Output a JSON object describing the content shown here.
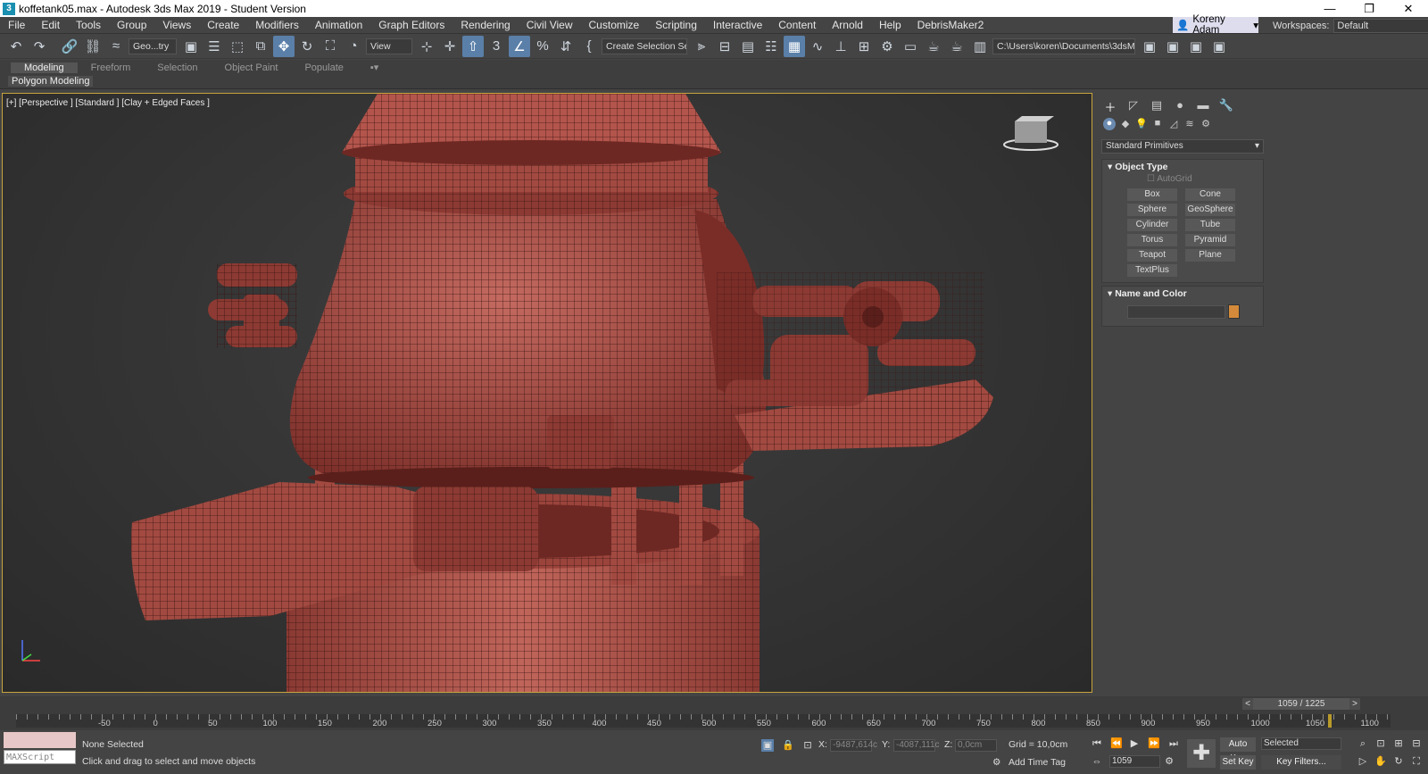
{
  "window": {
    "title": "koffetank05.max - Autodesk 3ds Max 2019 - Student Version",
    "app_icon": "3",
    "min": "—",
    "max": "❐",
    "close": "✕"
  },
  "menu": [
    "File",
    "Edit",
    "Tools",
    "Group",
    "Views",
    "Create",
    "Modifiers",
    "Animation",
    "Graph Editors",
    "Rendering",
    "Civil View",
    "Customize",
    "Scripting",
    "Interactive",
    "Content",
    "Arnold",
    "Help",
    "DebrisMaker2"
  ],
  "user": {
    "name": "Koreny Adam"
  },
  "workspace": {
    "label": "Workspaces:",
    "value": "Default"
  },
  "toolbar": {
    "selection_filter": "Geo...try",
    "ref_coord": "View",
    "named_selection": "Create Selection Se",
    "project_path": "C:\\Users\\koren\\Documents\\3dsMax"
  },
  "ribbon": {
    "tabs": [
      "Modeling",
      "Freeform",
      "Selection",
      "Object Paint",
      "Populate"
    ],
    "active": "Modeling",
    "sub": "Polygon Modeling"
  },
  "viewport": {
    "label": "[+] [Perspective ] [Standard ] [Clay + Edged Faces ]",
    "accent": "#c8a43c",
    "model_color": "#b3554c"
  },
  "command_panel": {
    "category": "Standard Primitives",
    "object_type": {
      "title": "Object Type",
      "autogrid": "AutoGrid",
      "buttons": [
        "Box",
        "Cone",
        "Sphere",
        "GeoSphere",
        "Cylinder",
        "Tube",
        "Torus",
        "Pyramid",
        "Teapot",
        "Plane",
        "TextPlus"
      ]
    },
    "name_color": {
      "title": "Name and Color",
      "swatch": "#d48a3a"
    }
  },
  "timeline": {
    "frame": "1059 / 1225",
    "ticks": [
      "-50",
      "0",
      "50",
      "100",
      "150",
      "200",
      "250",
      "300",
      "350",
      "400",
      "450",
      "500",
      "550",
      "600",
      "650",
      "700",
      "750",
      "800",
      "850",
      "900",
      "950",
      "1000",
      "1050",
      "1100"
    ]
  },
  "status": {
    "selection": "None Selected",
    "prompt": "Click and drag to select and move objects",
    "maxscript": "MAXScript Mi:",
    "x_label": "X:",
    "x": "-9487,614c",
    "y_label": "Y:",
    "y": "-4087,111c",
    "z_label": "Z:",
    "z": "0,0cm",
    "grid": "Grid = 10,0cm",
    "add_time_tag": "Add Time Tag",
    "auto_key": "Auto Key",
    "set_key": "Set Key",
    "selected": "Selected",
    "key_filters": "Key Filters...",
    "current_frame": "1059"
  }
}
